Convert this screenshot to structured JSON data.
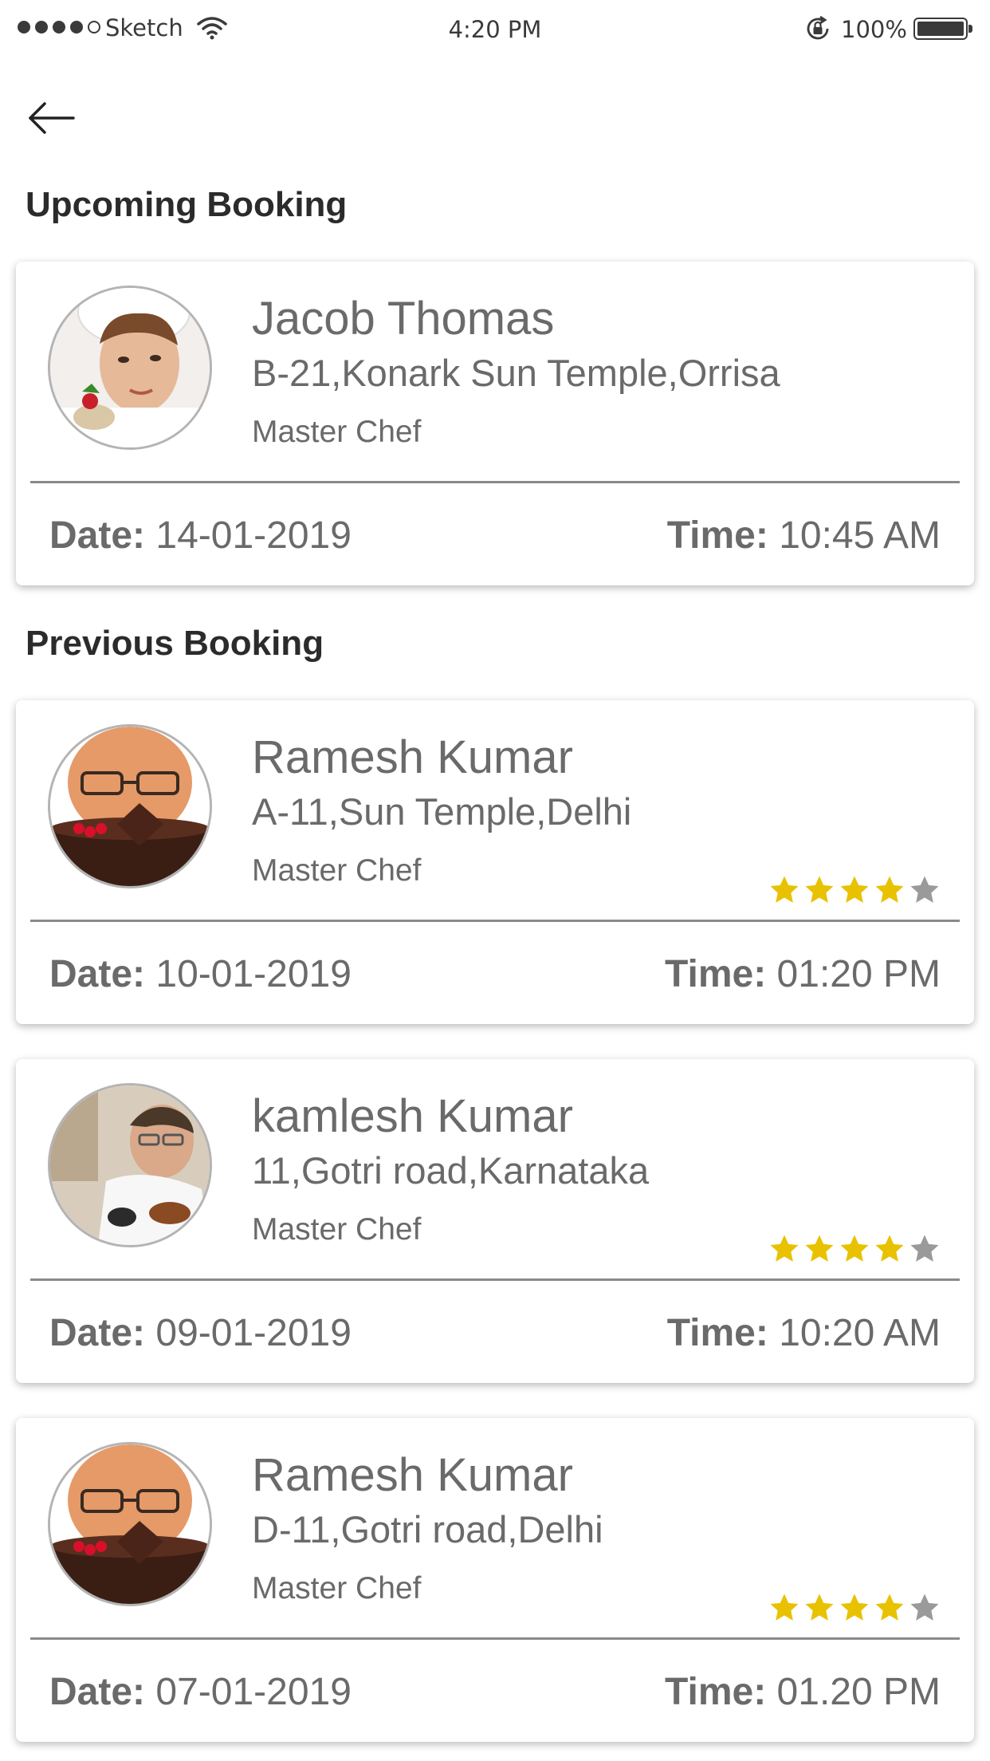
{
  "status_bar": {
    "carrier": "Sketch",
    "time": "4:20 PM",
    "battery": "100%",
    "signal_icon": "signal-dots-icon",
    "wifi_icon": "wifi-icon",
    "lock_icon": "rotation-lock-icon",
    "battery_icon": "battery-icon"
  },
  "header": {
    "back_icon": "back-arrow-icon"
  },
  "upcoming": {
    "heading": "Upcoming Booking",
    "bookings": [
      {
        "name": "Jacob Thomas",
        "address": "B-21,Konark Sun Temple,Orrisa",
        "role": "Master Chef",
        "date_label": "Date:",
        "date": "14-01-2019",
        "time_label": "Time:",
        "time": "10:45 AM"
      }
    ]
  },
  "previous": {
    "heading": "Previous Booking",
    "bookings": [
      {
        "name": "Ramesh Kumar",
        "address": "A-11,Sun Temple,Delhi",
        "role": "Master Chef",
        "rating": 4,
        "rating_max": 5,
        "date_label": "Date:",
        "date": "10-01-2019",
        "time_label": "Time:",
        "time": "01:20 PM"
      },
      {
        "name": "kamlesh Kumar",
        "address": "11,Gotri road,Karnataka",
        "role": "Master Chef",
        "rating": 4,
        "rating_max": 5,
        "date_label": "Date:",
        "date": "09-01-2019",
        "time_label": "Time:",
        "time": "10:20 AM"
      },
      {
        "name": "Ramesh Kumar",
        "address": "D-11,Gotri road,Delhi",
        "role": "Master Chef",
        "rating": 4,
        "rating_max": 5,
        "date_label": "Date:",
        "date": "07-01-2019",
        "time_label": "Time:",
        "time": "01.20 PM"
      }
    ]
  },
  "colors": {
    "star_filled": "#e8c200",
    "star_empty": "#9a9a9a",
    "heading_text": "#2b2b2b",
    "body_text": "#6a6a6a"
  }
}
